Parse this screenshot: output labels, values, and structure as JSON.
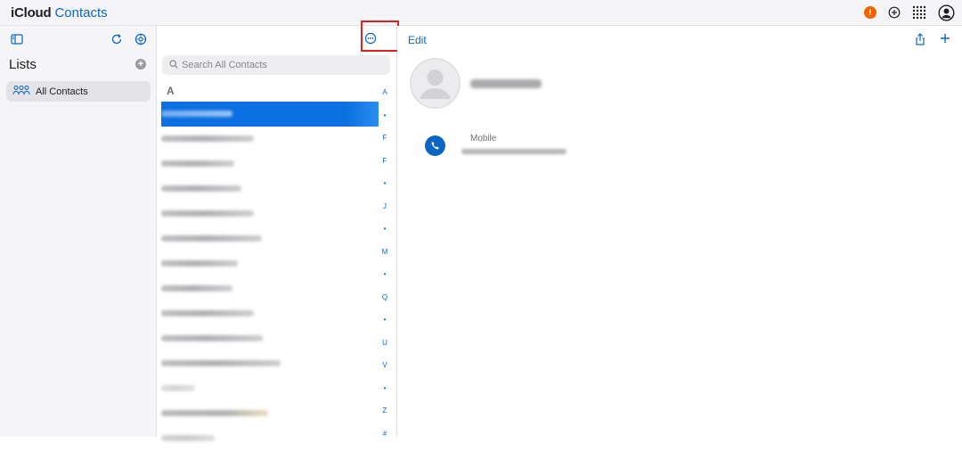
{
  "header": {
    "apple_glyph": "",
    "brand": "iCloud",
    "app_name": "Contacts",
    "alert_badge": "!",
    "icons": [
      "alert-icon",
      "add-circle-icon",
      "app-grid-icon",
      "account-icon"
    ],
    "accent_color": "#0a66c2",
    "alert_color": "#f56300"
  },
  "sidebar": {
    "tools": [
      "sidebar-toggle-icon",
      "refresh-icon",
      "settings-icon"
    ],
    "lists_title": "Lists",
    "items": [
      {
        "label": "All Contacts",
        "icon": "people-icon",
        "selected": true
      }
    ]
  },
  "contact_list": {
    "search_placeholder": "Search All Contacts",
    "section_letter": "A",
    "index_letters": [
      "A",
      "•",
      "F",
      "F",
      "•",
      "J",
      "•",
      "M",
      "•",
      "Q",
      "•",
      "U",
      "V",
      "•",
      "Z",
      "#"
    ],
    "rows_visible": 13,
    "selected_index": 0,
    "more_icon": "ellipsis-circle-icon"
  },
  "detail": {
    "edit_label": "Edit",
    "phone_label": "Mobile",
    "icons": [
      "share-icon",
      "add-icon",
      "phone-icon"
    ]
  }
}
